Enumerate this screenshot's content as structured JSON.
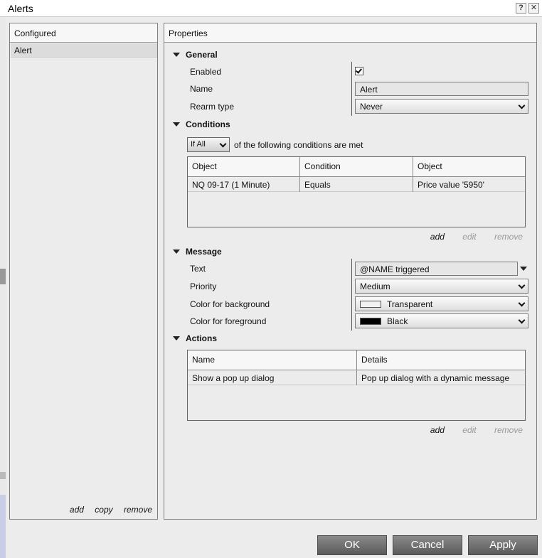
{
  "window": {
    "title": "Alerts",
    "help_label": "?",
    "close_label": "✕"
  },
  "configured": {
    "header": "Configured",
    "items": [
      {
        "label": "Alert"
      }
    ],
    "links": {
      "add": "add",
      "copy": "copy",
      "remove": "remove"
    }
  },
  "properties": {
    "header": "Properties",
    "general": {
      "title": "General",
      "enabled_label": "Enabled",
      "enabled": true,
      "name_label": "Name",
      "name_value": "Alert",
      "rearm_label": "Rearm type",
      "rearm_value": "Never"
    },
    "conditions": {
      "title": "Conditions",
      "mode_value": "If All",
      "suffix_text": "of the following conditions are met",
      "columns": [
        "Object",
        "Condition",
        "Object"
      ],
      "rows": [
        [
          "NQ 09-17 (1 Minute)",
          "Equals",
          "Price value '5950'"
        ]
      ],
      "links": {
        "add": "add",
        "edit": "edit",
        "remove": "remove"
      }
    },
    "message": {
      "title": "Message",
      "text_label": "Text",
      "text_value": "@NAME triggered",
      "priority_label": "Priority",
      "priority_value": "Medium",
      "bg_label": "Color for background",
      "bg_value": "Transparent",
      "bg_swatch": "#f2f2f2",
      "fg_label": "Color for foreground",
      "fg_value": "Black",
      "fg_swatch": "#000000"
    },
    "actions": {
      "title": "Actions",
      "columns": [
        "Name",
        "Details"
      ],
      "rows": [
        [
          "Show a pop up dialog",
          "Pop up dialog with a dynamic message"
        ]
      ],
      "links": {
        "add": "add",
        "edit": "edit",
        "remove": "remove"
      }
    }
  },
  "buttons": {
    "ok": "OK",
    "cancel": "Cancel",
    "apply": "Apply"
  }
}
